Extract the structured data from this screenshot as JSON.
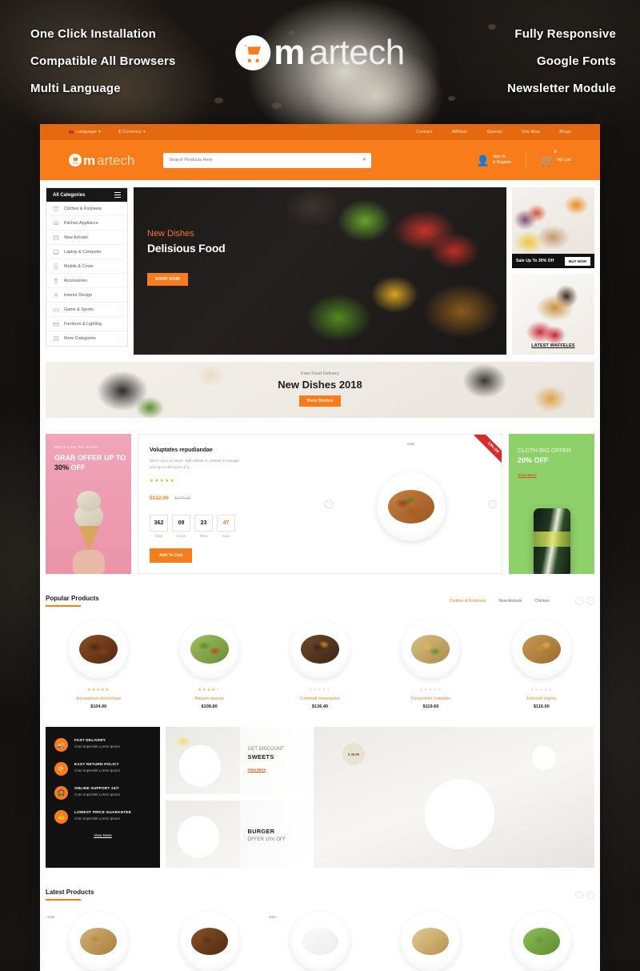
{
  "promo": {
    "left": [
      "One Click Installation",
      "Compatible All Browsers",
      "Multi Language"
    ],
    "right": [
      "Fully Responsive",
      "Google Fonts",
      "Newsletter Module"
    ],
    "brand_m": "m",
    "brand_rest": "artech"
  },
  "header": {
    "topbar_left": [
      "Language",
      "$ Currency"
    ],
    "topbar_right": [
      "Contact",
      "Affiliate",
      "Special",
      "Site Map",
      "Blogs"
    ],
    "logo_m": "m",
    "logo_rest": "artech",
    "search_placeholder": "Search Products Here",
    "search_value": "",
    "search_icon": "search-icon",
    "account_line1": "Sign In",
    "account_line2": "& Register",
    "cart_label": "My Cart",
    "cart_count": "0"
  },
  "categories": {
    "title": "All Categories",
    "items": [
      {
        "label": "Clothes & Footwear",
        "arrow": "›"
      },
      {
        "label": "Kitchen Appliance",
        "arrow": ""
      },
      {
        "label": "New Arrivals",
        "arrow": ""
      },
      {
        "label": "Laptop & Computer",
        "arrow": ""
      },
      {
        "label": "Mobile & Cover",
        "arrow": ""
      },
      {
        "label": "Accessories",
        "arrow": ""
      },
      {
        "label": "Interior Design",
        "arrow": ""
      },
      {
        "label": "Game & Sports",
        "arrow": "›"
      },
      {
        "label": "Furniture & Lighting",
        "arrow": ""
      },
      {
        "label": "More Categories",
        "arrow": "›"
      }
    ]
  },
  "hero": {
    "subtitle": "New Dishes",
    "title": "Delisious Food",
    "cta": "SHOP NOW"
  },
  "side_banners": {
    "top_text": "Sale Up To 30% Off",
    "top_cta": "BUY NOW",
    "bottom_caption": "LATEST WAFFELES"
  },
  "mid_banner": {
    "subtitle": "Free Food Delivery",
    "title": "New Dishes 2018",
    "cta": "View Dishes"
  },
  "deal": {
    "left_small": "ONLY FOR TO DAYS!",
    "left_title_1": "GRAB OFFER UP TO",
    "left_title_2a": "30%",
    "left_title_2b": " OFF",
    "ribbon": "12% Off",
    "sale_tag": "Sale",
    "product_name": "Voluptates repudiandae",
    "product_desc": "More room to move. With 80GB or 160GB of storage and up to 40 hours of b..",
    "rating_filled": 5,
    "price_new": "$122.00",
    "price_old": "$140.00",
    "countdown": [
      {
        "value": "362",
        "label": "Days"
      },
      {
        "value": "09",
        "label": "Hours"
      },
      {
        "value": "23",
        "label": "Mins"
      },
      {
        "value": "47",
        "label": "Secs"
      }
    ],
    "add_to_cart": "Add To Cart",
    "right_title_1": "CLOTH BIG OFFER",
    "right_title_2": "20% OFF",
    "right_cta": "View More"
  },
  "popular": {
    "title": "Popular Products",
    "tabs": [
      {
        "label": "Clothes & Footwear",
        "active": true
      },
      {
        "label": "New Arrivals",
        "active": false
      },
      {
        "label": "Chicken",
        "active": false
      }
    ],
    "prev": "‹",
    "next": "›",
    "products": [
      {
        "name": "Accusantium doloremque",
        "price": "$104.00",
        "rating": 5
      },
      {
        "name": "Aliquam quaerat",
        "price": "$108.80",
        "rating": 4
      },
      {
        "name": "Commodi consequatur",
        "price": "$136.40",
        "rating": 0
      },
      {
        "name": "Consectetur hampden",
        "price": "$119.60",
        "rating": 0
      },
      {
        "name": "Exercitat virginia",
        "price": "$116.00",
        "rating": 0
      }
    ]
  },
  "services": {
    "items": [
      {
        "title": "FAST DELIVERY",
        "desc": "Cras Imperdiet Lorem Ipsum",
        "icon": "truck-icon"
      },
      {
        "title": "EASY RETURN POLICY",
        "desc": "Cras Imperdiet Lorem Ipsum",
        "icon": "refund-icon"
      },
      {
        "title": "ONLINE SUPPORT 24/7",
        "desc": "Cras Imperdiet Lorem Ipsum",
        "icon": "headset-icon"
      },
      {
        "title": "LOWEST PRICE GUARANTEE",
        "desc": "Cras Imperdiet Lorem Ipsum",
        "icon": "thumbs-up-icon"
      }
    ],
    "view_more": "View More"
  },
  "mini_banners": [
    {
      "line1": "GET DISCOUNT",
      "line2": "SWEETS",
      "cta": "View More"
    },
    {
      "line1": "",
      "line2": "BURGER",
      "sub": "OFFER 10% OFF"
    }
  ],
  "right_banner": {
    "badge": "$ 36.99"
  },
  "latest": {
    "title": "Latest Products",
    "prev": "‹",
    "next": "›",
    "products": [
      {
        "sale": "Sale"
      },
      {
        "sale": ""
      },
      {
        "sale": "Sale"
      },
      {
        "sale": ""
      },
      {
        "sale": ""
      }
    ]
  },
  "colors": {
    "accent": "#f97c1b",
    "accent_dark": "#e5690f",
    "dark": "#111111",
    "green": "#8ed06a",
    "pink": "#eea0b4",
    "red": "#d92b2b"
  }
}
